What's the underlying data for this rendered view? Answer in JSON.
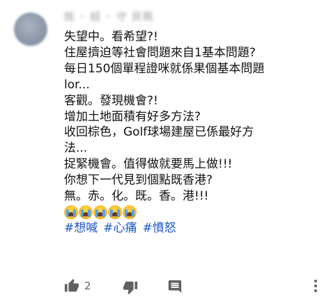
{
  "comment": {
    "author_name": "既 ◦ 紐 ◦ 守 貝珮",
    "lines": [
      "失望中。看希望?!",
      "住屋擠迫等社會問題來自1基本問題?",
      "每日150個單程證咪就係果個基本問題",
      "lor...",
      "客觀。發現機會?!",
      "增加土地面積有好多方法?",
      "收回棕色，Golf球場建屋已係最好方",
      "法...",
      "捉緊機會。值得做就要馬上做!!!",
      "你想下一代見到個點既香港?",
      "無。赤。化。既。香。港!!!"
    ],
    "emoji_icons": [
      "loudly-crying-face-icon",
      "loudly-crying-face-icon",
      "loudly-crying-face-icon",
      "loudly-crying-face-icon",
      "loudly-crying-face-icon"
    ],
    "hashtags": [
      "#想喊",
      "#心痛",
      "#憤怒"
    ]
  },
  "actions": {
    "like_count": "2",
    "like_icon": "thumbs-up-icon",
    "dislike_icon": "thumbs-down-icon",
    "reply_icon": "reply-icon",
    "more_icon": "more-vertical-icon"
  },
  "colors": {
    "hashtag": "#1a56c9",
    "text": "#111111",
    "icon": "#606060"
  }
}
